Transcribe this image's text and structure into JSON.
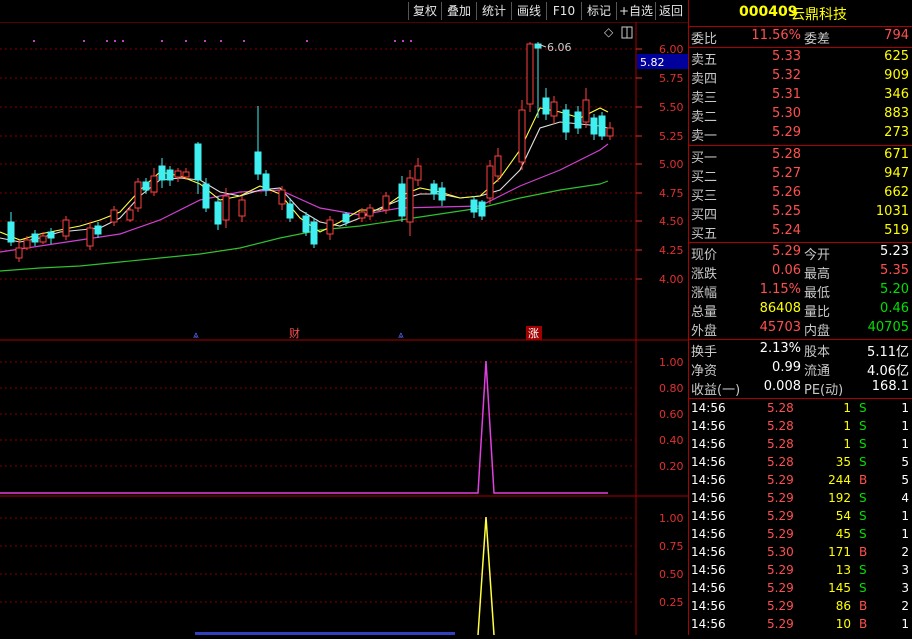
{
  "toolbar": {
    "buttons": [
      "复权",
      "叠加",
      "统计",
      "画线",
      "F10",
      "标记",
      "+自选",
      "返回"
    ]
  },
  "main_chart": {
    "price_ticks": [
      "6.00",
      "5.75",
      "5.50",
      "5.25",
      "5.00",
      "4.75",
      "4.50",
      "4.25",
      "4.00"
    ],
    "current_price_tag": "5.82",
    "high_label": "6.06",
    "events": [
      "财",
      "涨"
    ]
  },
  "sub_chart1": {
    "ticks": [
      "1.00",
      "0.80",
      "0.60",
      "0.40",
      "0.20"
    ]
  },
  "sub_chart2": {
    "ticks": [
      "1.00",
      "0.75",
      "0.50",
      "0.25"
    ]
  },
  "stock": {
    "code": "000409",
    "name": "云鼎科技"
  },
  "order_book": {
    "webi_label": "委比",
    "webi_value": "11.56%",
    "weicha_label": "委差",
    "weicha_value": "794",
    "asks": [
      {
        "label": "卖五",
        "price": "5.33",
        "vol": "625"
      },
      {
        "label": "卖四",
        "price": "5.32",
        "vol": "909"
      },
      {
        "label": "卖三",
        "price": "5.31",
        "vol": "346"
      },
      {
        "label": "卖二",
        "price": "5.30",
        "vol": "883"
      },
      {
        "label": "卖一",
        "price": "5.29",
        "vol": "273"
      }
    ],
    "bids": [
      {
        "label": "买一",
        "price": "5.28",
        "vol": "671"
      },
      {
        "label": "买二",
        "price": "5.27",
        "vol": "947"
      },
      {
        "label": "买三",
        "price": "5.26",
        "vol": "662"
      },
      {
        "label": "买四",
        "price": "5.25",
        "vol": "1031"
      },
      {
        "label": "买五",
        "price": "5.24",
        "vol": "519"
      }
    ]
  },
  "quote": {
    "rows": [
      {
        "l1": "现价",
        "v1": "5.29",
        "c1": "red",
        "l2": "今开",
        "v2": "5.23",
        "c2": "white"
      },
      {
        "l1": "涨跌",
        "v1": "0.06",
        "c1": "red",
        "l2": "最高",
        "v2": "5.35",
        "c2": "red"
      },
      {
        "l1": "涨幅",
        "v1": "1.15%",
        "c1": "red",
        "l2": "最低",
        "v2": "5.20",
        "c2": "green"
      },
      {
        "l1": "总量",
        "v1": "86408",
        "c1": "yellow",
        "l2": "量比",
        "v2": "0.46",
        "c2": "green"
      },
      {
        "l1": "外盘",
        "v1": "45703",
        "c1": "red",
        "l2": "内盘",
        "v2": "40705",
        "c2": "green"
      }
    ]
  },
  "fundamentals": {
    "rows": [
      {
        "l1": "换手",
        "v1": "2.13%",
        "l2": "股本",
        "v2": "5.11亿"
      },
      {
        "l1": "净资",
        "v1": "0.99",
        "l2": "流通",
        "v2": "4.06亿"
      },
      {
        "l1": "收益(一)",
        "v1": "0.008",
        "l2": "PE(动)",
        "v2": "168.1"
      }
    ]
  },
  "ticks": [
    {
      "time": "14:56",
      "price": "5.28",
      "vol": "1",
      "side": "S",
      "n": "1"
    },
    {
      "time": "14:56",
      "price": "5.28",
      "vol": "1",
      "side": "S",
      "n": "1"
    },
    {
      "time": "14:56",
      "price": "5.28",
      "vol": "1",
      "side": "S",
      "n": "1"
    },
    {
      "time": "14:56",
      "price": "5.28",
      "vol": "35",
      "side": "S",
      "n": "5"
    },
    {
      "time": "14:56",
      "price": "5.29",
      "vol": "244",
      "side": "B",
      "n": "5"
    },
    {
      "time": "14:56",
      "price": "5.29",
      "vol": "192",
      "side": "S",
      "n": "4"
    },
    {
      "time": "14:56",
      "price": "5.29",
      "vol": "54",
      "side": "S",
      "n": "1"
    },
    {
      "time": "14:56",
      "price": "5.29",
      "vol": "45",
      "side": "S",
      "n": "1"
    },
    {
      "time": "14:56",
      "price": "5.30",
      "vol": "171",
      "side": "B",
      "n": "2"
    },
    {
      "time": "14:56",
      "price": "5.29",
      "vol": "13",
      "side": "S",
      "n": "3"
    },
    {
      "time": "14:56",
      "price": "5.29",
      "vol": "145",
      "side": "S",
      "n": "3"
    },
    {
      "time": "14:56",
      "price": "5.29",
      "vol": "86",
      "side": "B",
      "n": "2"
    },
    {
      "time": "14:56",
      "price": "5.29",
      "vol": "10",
      "side": "B",
      "n": "1"
    }
  ]
}
